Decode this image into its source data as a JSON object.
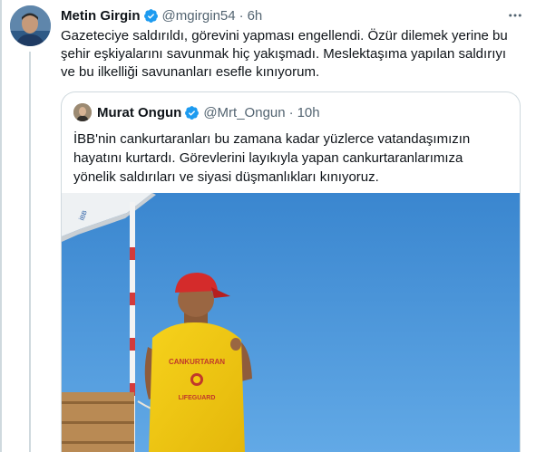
{
  "tweet": {
    "author_name": "Metin Girgin",
    "handle": "@mgirgin54",
    "separator": "·",
    "time": "6h",
    "text": "Gazeteciye saldırıldı, görevini yapması engellendi. Özür dilemek yerine bu şehir eşkiyalarını savunmak hiç yakışmadı. Meslektaşıma yapılan saldırıyı ve bu ilkelliği savunanları esefle kınıyorum."
  },
  "quoted_tweet": {
    "author_name": "Murat Ongun",
    "handle": "@Mrt_Ongun",
    "separator": "·",
    "time": "10h",
    "text": "İBB'nin cankurtaranları bu zamana kadar yüzlerce vatandaşımızın hayatını kurtardı. Görevlerini layıkıyla yapan cankurtaranlarımıza yönelik saldırıları ve siyasi düşmanlıkları kınıyoruz.",
    "media": {
      "shirt_text": "CANKURTARAN",
      "shirt_sub": "LIFEGUARD",
      "flag_text": "İBB"
    }
  },
  "icons": {
    "verified": "verified-badge-icon",
    "more": "more-options-icon"
  },
  "colors": {
    "verified": "#1d9bf0",
    "secondary_text": "#536471",
    "border": "#cfd9de",
    "sky": "#3c8fd6",
    "shirt": "#f2c90f",
    "cap": "#d42b2b"
  }
}
